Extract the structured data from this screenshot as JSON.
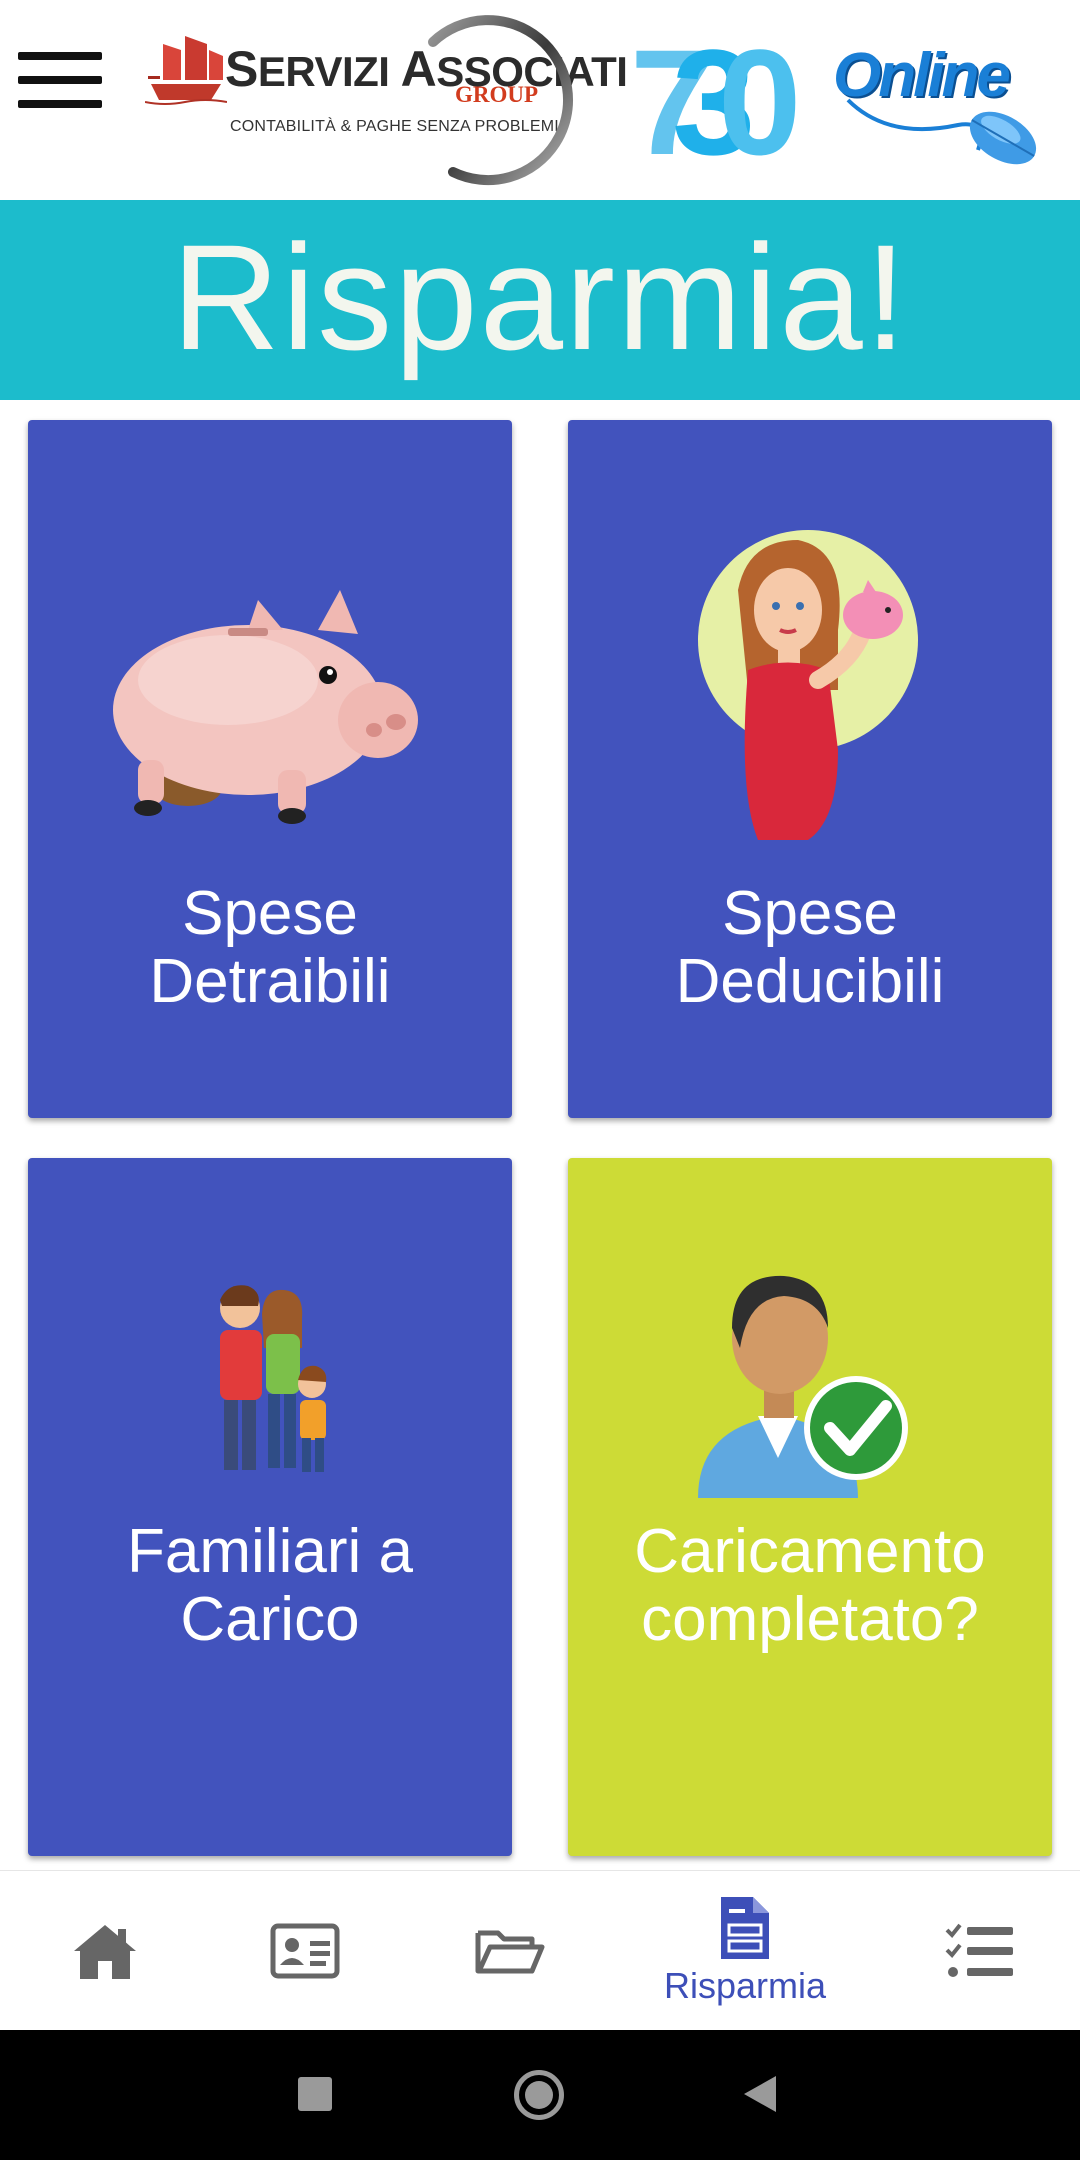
{
  "header": {
    "brand_first": "S",
    "brand_name_1": "ERVIZI ",
    "brand_second": "A",
    "brand_name_2": "SSOCIATI",
    "brand_group": "GROUP",
    "brand_tagline": "CONTABILITÀ & PAGHE SENZA PROBLEMI",
    "logo_730": "730",
    "logo_online": "Online"
  },
  "banner": {
    "title": "Risparmia!"
  },
  "tiles": [
    {
      "label": "Spese\nDetraibili",
      "image": "piggy-bank-icon",
      "color": "#4253bd"
    },
    {
      "label": "Spese\nDeducibili",
      "image": "woman-piggy-bank-icon",
      "color": "#4253bd"
    },
    {
      "label": "Familiari a\nCarico",
      "image": "family-icon",
      "color": "#4253bd"
    },
    {
      "label": "Caricamento\ncompletato?",
      "image": "user-checkmark-icon",
      "color": "#cddb36"
    }
  ],
  "bottom_nav": {
    "items": [
      {
        "icon": "home-icon",
        "label": ""
      },
      {
        "icon": "id-card-icon",
        "label": ""
      },
      {
        "icon": "folder-open-icon",
        "label": ""
      },
      {
        "icon": "document-icon",
        "label": "Risparmia",
        "active": true
      },
      {
        "icon": "checklist-icon",
        "label": ""
      }
    ],
    "active_color": "#3d4fb8",
    "inactive_color": "#666666"
  },
  "system_bar": {
    "buttons": [
      "recents-icon",
      "home-circle-icon",
      "back-icon"
    ]
  },
  "colors": {
    "banner": "#1cbccc",
    "tile_blue": "#4253bd",
    "tile_lime": "#cddb36"
  }
}
